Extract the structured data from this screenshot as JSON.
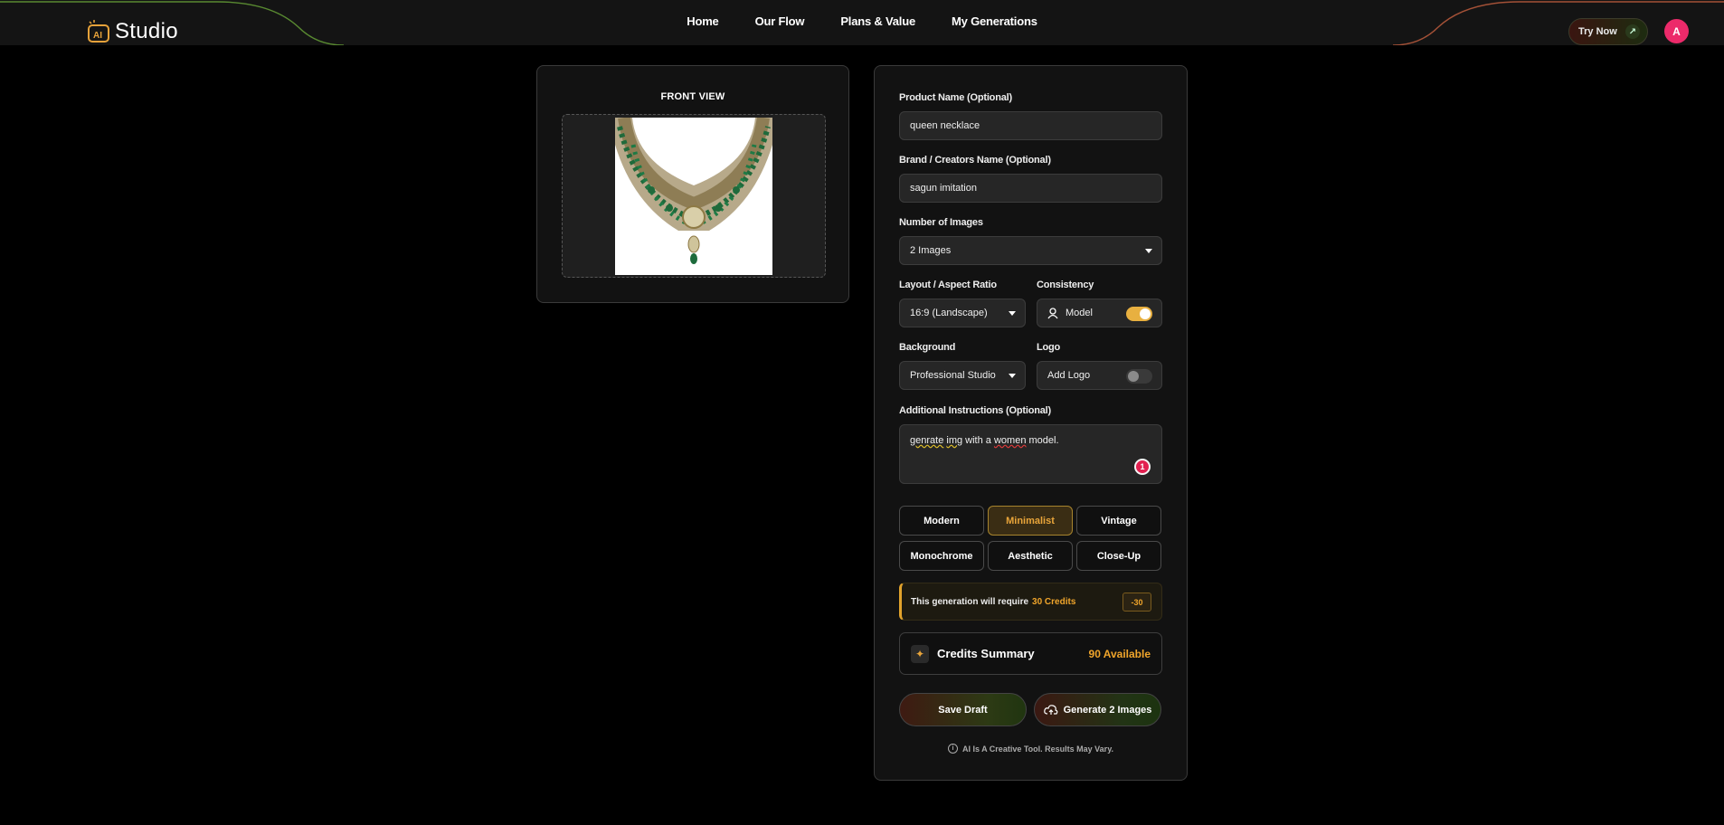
{
  "header": {
    "logo_text": "Studio",
    "logo_badge": "AI",
    "nav": [
      "Home",
      "Our Flow",
      "Plans & Value",
      "My Generations"
    ],
    "try_label": "Try Now",
    "avatar_initial": "A"
  },
  "preview": {
    "title": "FRONT VIEW"
  },
  "form": {
    "product_name_label": "Product Name (Optional)",
    "product_name_value": "queen necklace",
    "brand_label": "Brand / Creators Name (Optional)",
    "brand_value": "sagun imitation",
    "num_images_label": "Number of Images",
    "num_images_value": "2 Images",
    "layout_label": "Layout / Aspect Ratio",
    "layout_value": "16:9 (Landscape)",
    "consistency_label": "Consistency",
    "consistency_option": "Model",
    "consistency_on": true,
    "background_label": "Background",
    "background_value": "Professional Studio",
    "logo_label": "Logo",
    "logo_option": "Add Logo",
    "logo_on": false,
    "instructions_label": "Additional Instructions (Optional)",
    "instructions_words": [
      "genrate",
      "img",
      "with a",
      "women",
      "model."
    ],
    "notification_count": "1"
  },
  "styles": {
    "options": [
      "Modern",
      "Minimalist",
      "Vintage",
      "Monochrome",
      "Aesthetic",
      "Close-Up"
    ],
    "selected": "Minimalist"
  },
  "credits": {
    "note_prefix": "This generation will require",
    "note_amount": "30 Credits",
    "cost_badge": "-30",
    "summary_title": "Credits Summary",
    "available": "90 Available"
  },
  "actions": {
    "save_label": "Save Draft",
    "generate_label": "Generate 2 Images",
    "disclaimer": "AI Is A Creative Tool. Results May Vary."
  },
  "colors": {
    "accent": "#f0a52b",
    "toggle_on": "#e8b040",
    "avatar": "#ec2a6a"
  }
}
